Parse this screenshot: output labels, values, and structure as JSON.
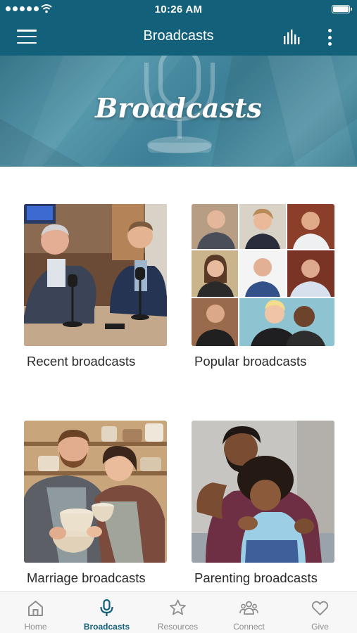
{
  "status_bar": {
    "time": "10:26 AM"
  },
  "header": {
    "title": "Broadcasts"
  },
  "hero": {
    "title": "Broadcasts"
  },
  "categories": [
    {
      "label": "Recent broadcasts"
    },
    {
      "label": "Popular broadcasts"
    },
    {
      "label": "Marriage broadcasts"
    },
    {
      "label": "Parenting broadcasts"
    }
  ],
  "tabs": [
    {
      "label": "Home",
      "icon": "home-icon"
    },
    {
      "label": "Broadcasts",
      "icon": "microphone-icon",
      "active": true
    },
    {
      "label": "Resources",
      "icon": "star-icon"
    },
    {
      "label": "Connect",
      "icon": "people-icon"
    },
    {
      "label": "Give",
      "icon": "heart-icon"
    }
  ],
  "colors": {
    "accent": "#13607a",
    "tab_inactive": "#8e8e8e"
  }
}
